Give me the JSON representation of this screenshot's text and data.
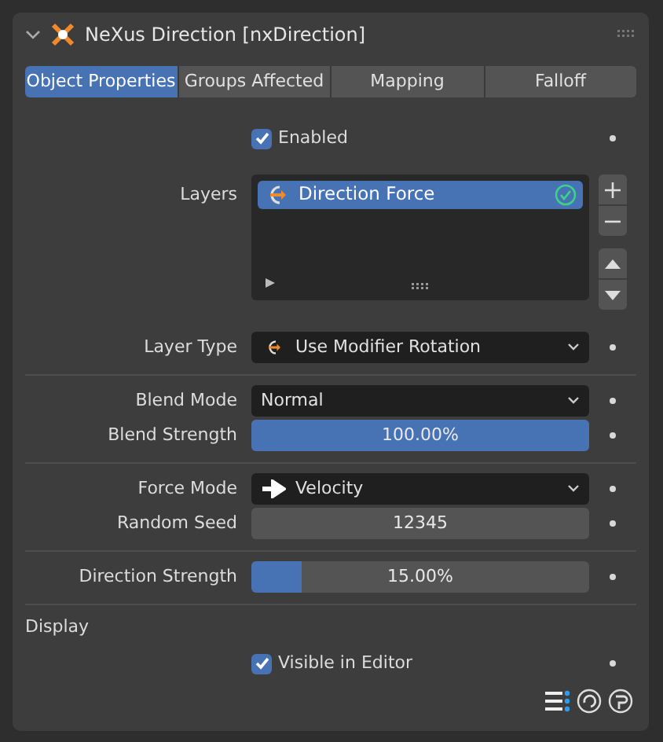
{
  "panel": {
    "title": "NeXus Direction [nxDirection]",
    "expanded": true
  },
  "tabs": [
    {
      "label": "Object Properties",
      "selected": true
    },
    {
      "label": "Groups Affected",
      "selected": false
    },
    {
      "label": "Mapping",
      "selected": false
    },
    {
      "label": "Falloff",
      "selected": false
    }
  ],
  "enabled": {
    "label": "Enabled",
    "checked": true
  },
  "layers": {
    "label": "Layers",
    "items": [
      {
        "name": "Direction Force",
        "selected": true,
        "active": true
      }
    ]
  },
  "sections": [
    [
      {
        "kind": "dropdown",
        "label": "Layer Type",
        "value": "Use Modifier Rotation"
      }
    ],
    [
      {
        "kind": "dropdown",
        "label": "Blend Mode",
        "value": "Normal"
      },
      {
        "kind": "slider",
        "label": "Blend Strength",
        "level": 1.0,
        "reading": "100.00%"
      }
    ],
    [
      {
        "kind": "dropdown",
        "label": "Force Mode",
        "value": "Velocity"
      },
      {
        "kind": "number",
        "label": "Random Seed",
        "value": "12345"
      }
    ],
    [
      {
        "kind": "slider",
        "label": "Direction Strength",
        "level": 0.15,
        "reading": "15.00%"
      }
    ]
  ],
  "display": {
    "heading": "Display",
    "checkbox": {
      "label": "Visible in Editor",
      "checked": true
    }
  }
}
